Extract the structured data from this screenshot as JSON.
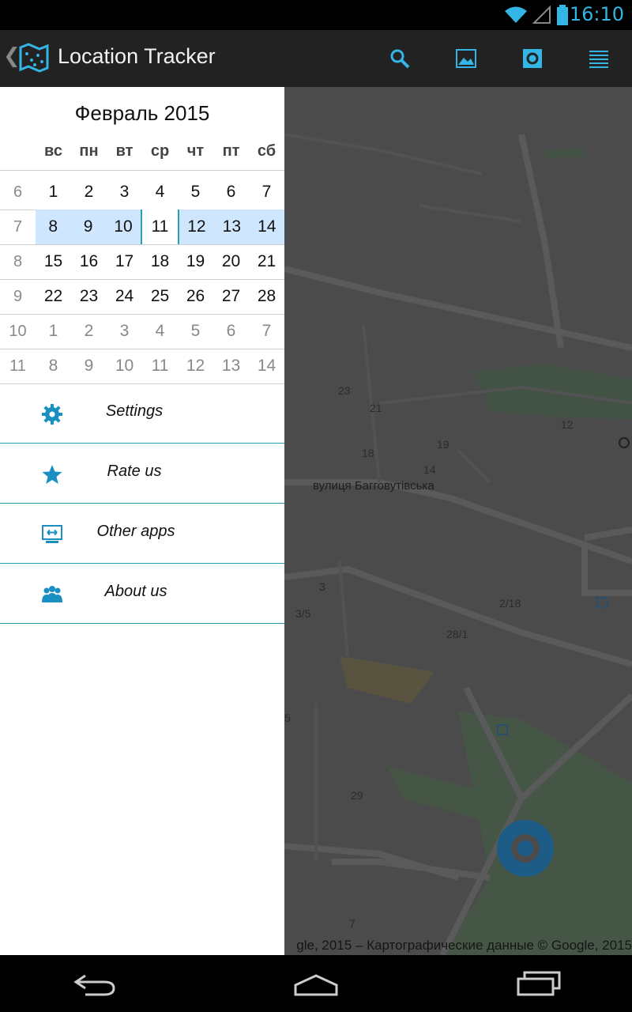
{
  "status_bar": {
    "time": "16:10"
  },
  "app": {
    "title": "Location Tracker"
  },
  "calendar": {
    "month_title": "Февраль 2015",
    "weekdays": [
      "вс",
      "пн",
      "вт",
      "ср",
      "чт",
      "пт",
      "сб"
    ],
    "weeks": [
      {
        "num": "6",
        "days": [
          "1",
          "2",
          "3",
          "4",
          "5",
          "6",
          "7"
        ]
      },
      {
        "num": "7",
        "days": [
          "8",
          "9",
          "10",
          "11",
          "12",
          "13",
          "14"
        ]
      },
      {
        "num": "8",
        "days": [
          "15",
          "16",
          "17",
          "18",
          "19",
          "20",
          "21"
        ]
      },
      {
        "num": "9",
        "days": [
          "22",
          "23",
          "24",
          "25",
          "26",
          "27",
          "28"
        ]
      },
      {
        "num": "10",
        "days": [
          "1",
          "2",
          "3",
          "4",
          "5",
          "6",
          "7"
        ]
      },
      {
        "num": "11",
        "days": [
          "8",
          "9",
          "10",
          "11",
          "12",
          "13",
          "14"
        ]
      }
    ]
  },
  "menu": {
    "settings": "Settings",
    "rate": "Rate us",
    "other_apps": "Other apps",
    "about": "About us"
  },
  "map": {
    "street": "вулиця Багговутівська",
    "labels": [
      "23",
      "21",
      "19",
      "18",
      "14",
      "12",
      "3",
      "3/5",
      "2/18",
      "28/1",
      "29",
      "7",
      "5"
    ],
    "attribution": "gle, 2015 – Картографические данные © Google, 2015"
  },
  "colors": {
    "accent": "#33b5e5",
    "selected_week": "#cfe6ff",
    "divider": "#2aa0b5"
  }
}
